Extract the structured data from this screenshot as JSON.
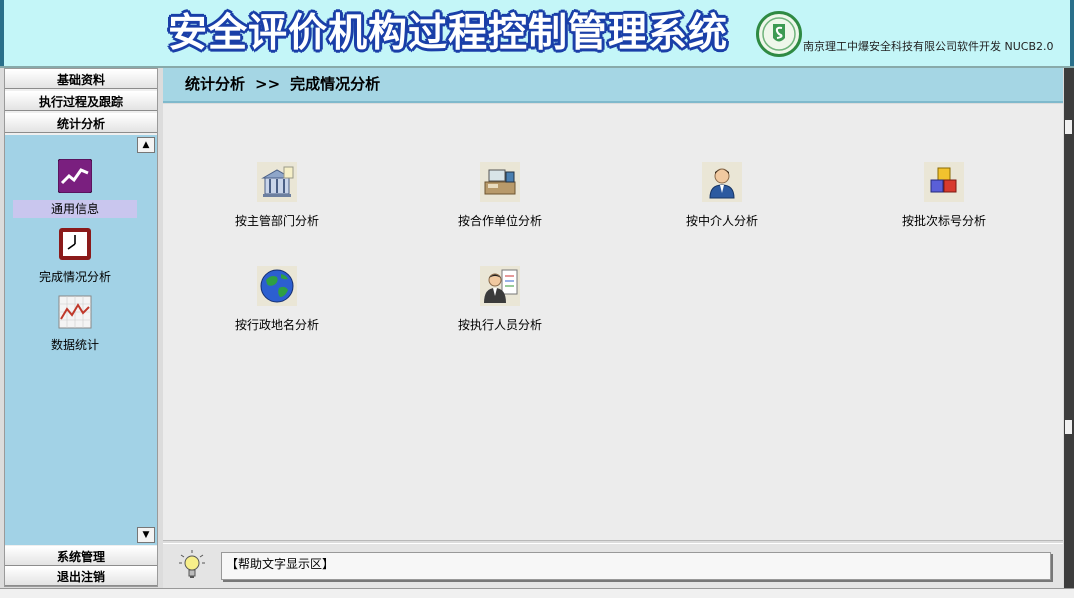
{
  "header": {
    "title": "安全评价机构过程控制管理系统",
    "company": "南京理工中爆安全科技有限公司软件开发  NUCB2.0"
  },
  "nav": {
    "top_buttons": [
      "基础资料",
      "执行过程及跟踪",
      "统计分析"
    ],
    "bottom_buttons": [
      "系统管理",
      "退出注销"
    ],
    "items": [
      {
        "label": "通用信息",
        "icon": "stock-chart-icon",
        "selected": true
      },
      {
        "label": "完成情况分析",
        "icon": "clock-icon",
        "selected": false
      },
      {
        "label": "数据统计",
        "icon": "line-graph-icon",
        "selected": false
      }
    ],
    "scroll_up": "▲",
    "scroll_down": "▼"
  },
  "breadcrumb": {
    "section": "统计分析",
    "separator": ">>",
    "page": "完成情况分析"
  },
  "tiles": [
    {
      "label": "按主管部门分析",
      "icon": "government-building-icon"
    },
    {
      "label": "按合作单位分析",
      "icon": "office-desk-icon"
    },
    {
      "label": "按中介人分析",
      "icon": "person-icon"
    },
    {
      "label": "按批次标号分析",
      "icon": "blocks-icon"
    },
    {
      "label": "按行政地名分析",
      "icon": "globe-icon"
    },
    {
      "label": "按执行人员分析",
      "icon": "staff-board-icon"
    }
  ],
  "help": {
    "text": "【帮助文字显示区】",
    "icon": "lightbulb-icon"
  },
  "colors": {
    "header_bg": "#c4f6f8",
    "title_outline": "#1a3fa8",
    "panel_bg": "#a2d2e6",
    "breadcrumb_bg": "#a5d6e4",
    "selected_item": "#c9c6ee"
  }
}
